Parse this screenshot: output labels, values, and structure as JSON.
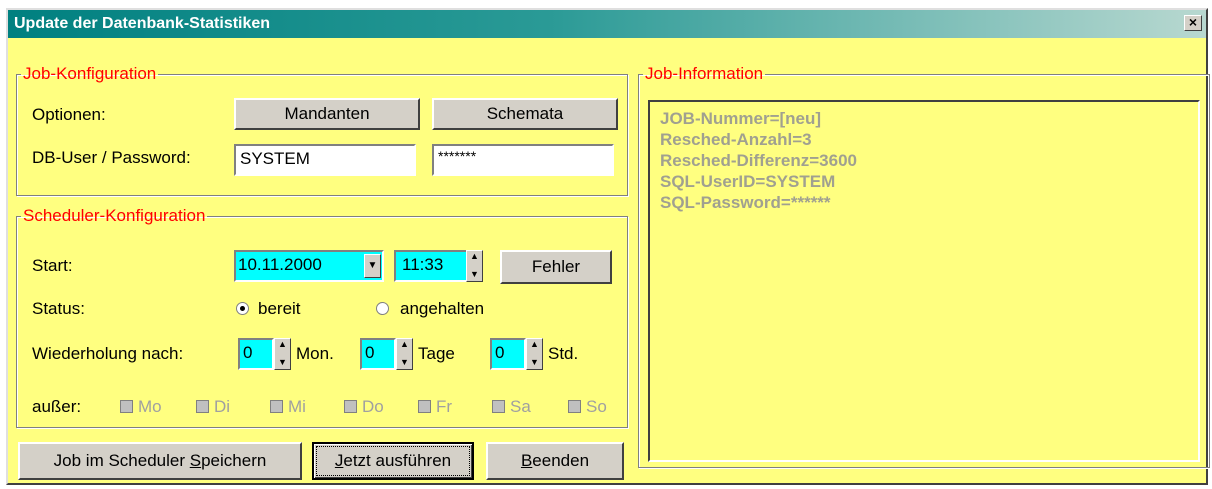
{
  "window": {
    "title": "Update der Datenbank-Statistiken",
    "close_glyph": "×"
  },
  "job_config": {
    "legend": "Job-Konfiguration",
    "options_label": "Optionen:",
    "mandanten_label": "Mandanten",
    "schemata_label": "Schemata",
    "dbuser_label": "DB-User / Password:",
    "user_value": "SYSTEM",
    "password_value": "*******"
  },
  "scheduler_config": {
    "legend": "Scheduler-Konfiguration",
    "start_label": "Start:",
    "date_value": "10.11.2000",
    "time_value": "11:33",
    "fehler_label": "Fehler",
    "status_label": "Status:",
    "status_ready": "bereit",
    "status_paused": "angehalten",
    "selected_status": "bereit",
    "repeat_label": "Wiederholung nach:",
    "months_value": "0",
    "months_unit": "Mon.",
    "days_value": "0",
    "days_unit": "Tage",
    "hours_value": "0",
    "hours_unit": "Std.",
    "except_label": "außer:",
    "weekdays": [
      "Mo",
      "Di",
      "Mi",
      "Do",
      "Fr",
      "Sa",
      "So"
    ]
  },
  "buttons": {
    "save_pre": "Job im Scheduler ",
    "save_ul": "S",
    "save_post": "peichern",
    "run_ul": "J",
    "run_post": "etzt ausführen",
    "exit_ul": "B",
    "exit_post": "eenden"
  },
  "job_info": {
    "legend": "Job-Information",
    "lines": [
      "JOB-Nummer=[neu]",
      "Resched-Anzahl=3",
      "Resched-Differenz=3600",
      "SQL-UserID=SYSTEM",
      "SQL-Password=******"
    ]
  },
  "colors": {
    "title_bar": "#008080",
    "window_bg": "#ffff80",
    "legend": "#ff0000",
    "highlight": "#00ffff"
  }
}
